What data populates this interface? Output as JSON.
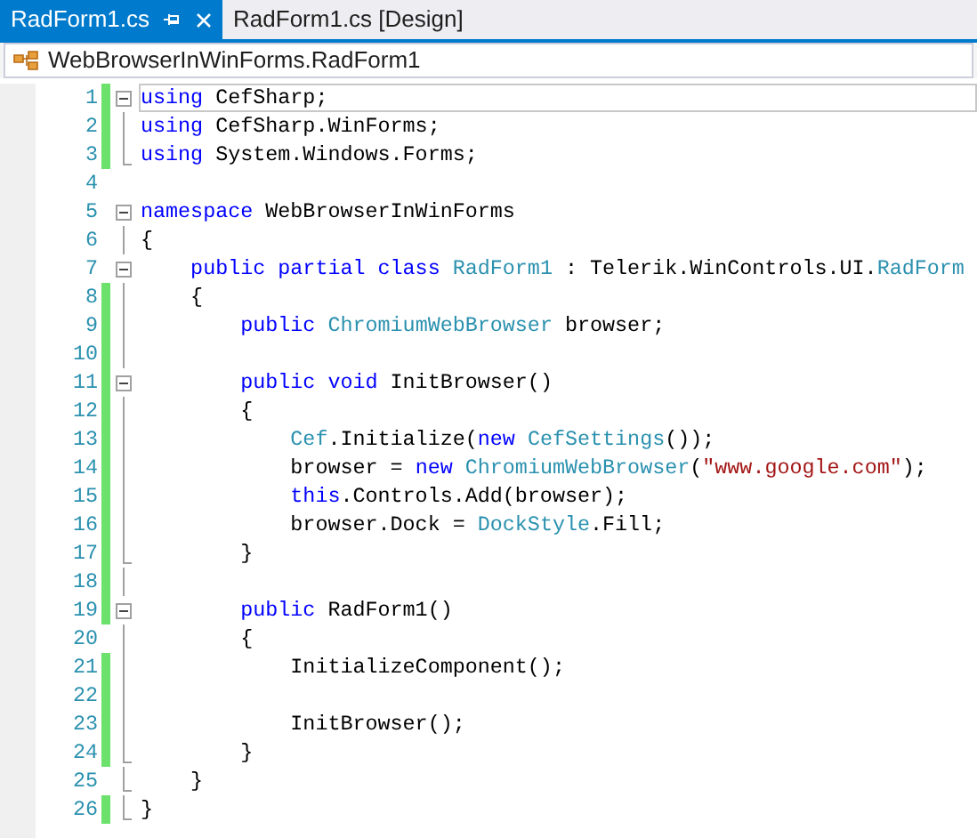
{
  "tabs": [
    {
      "label": "RadForm1.cs",
      "selected": true
    },
    {
      "label": "RadForm1.cs [Design]",
      "selected": false
    }
  ],
  "navigation": {
    "label": "WebBrowserInWinForms.RadForm1"
  },
  "lines": [
    {
      "number": "1",
      "changed": true,
      "current": true,
      "kind": "start",
      "tokens": [
        {
          "kind": "keyword",
          "text": "using"
        },
        {
          "kind": "plain",
          "text": " CefSharp;"
        }
      ]
    },
    {
      "number": "2",
      "changed": true,
      "current": false,
      "kind": "inside",
      "tokens": [
        {
          "kind": "keyword",
          "text": "using"
        },
        {
          "kind": "plain",
          "text": " CefSharp.WinForms;"
        }
      ]
    },
    {
      "number": "3",
      "changed": true,
      "current": false,
      "kind": "end",
      "tokens": [
        {
          "kind": "keyword",
          "text": "using"
        },
        {
          "kind": "plain",
          "text": " System.Windows.Forms;"
        }
      ]
    },
    {
      "number": "4",
      "changed": false,
      "current": false,
      "kind": "outside"
    },
    {
      "number": "5",
      "changed": false,
      "current": false,
      "kind": "start",
      "tokens": [
        {
          "kind": "keyword",
          "text": "namespace"
        },
        {
          "kind": "plain",
          "text": " WebBrowserInWinForms"
        }
      ]
    },
    {
      "number": "6",
      "changed": false,
      "current": false,
      "kind": "inside",
      "tokens": [
        {
          "kind": "plain",
          "text": "{"
        }
      ]
    },
    {
      "number": "7",
      "changed": false,
      "current": false,
      "kind": "start",
      "tokens": [
        {
          "kind": "keyword",
          "text": "    public partial class "
        },
        {
          "kind": "type",
          "text": "RadForm1"
        },
        {
          "kind": "plain",
          "text": " : Telerik.WinControls.UI."
        },
        {
          "kind": "type",
          "text": "RadForm"
        }
      ]
    },
    {
      "number": "8",
      "changed": true,
      "current": false,
      "kind": "inside",
      "tokens": [
        {
          "kind": "plain",
          "text": "    {"
        }
      ]
    },
    {
      "number": "9",
      "changed": true,
      "current": false,
      "kind": "inside",
      "tokens": [
        {
          "kind": "keyword",
          "text": "        public "
        },
        {
          "kind": "type",
          "text": "ChromiumWebBrowser"
        },
        {
          "kind": "plain",
          "text": " browser;"
        }
      ]
    },
    {
      "number": "10",
      "changed": true,
      "current": false,
      "kind": "inside"
    },
    {
      "number": "11",
      "changed": true,
      "current": false,
      "kind": "start",
      "tokens": [
        {
          "kind": "keyword",
          "text": "        public void"
        },
        {
          "kind": "plain",
          "text": " InitBrowser()"
        }
      ]
    },
    {
      "number": "12",
      "changed": true,
      "current": false,
      "kind": "inside",
      "tokens": [
        {
          "kind": "plain",
          "text": "        {"
        }
      ]
    },
    {
      "number": "13",
      "changed": true,
      "current": false,
      "kind": "inside",
      "tokens": [
        {
          "kind": "type",
          "text": "            Cef"
        },
        {
          "kind": "plain",
          "text": ".Initialize("
        },
        {
          "kind": "keyword",
          "text": "new "
        },
        {
          "kind": "type",
          "text": "CefSettings"
        },
        {
          "kind": "plain",
          "text": "());"
        }
      ]
    },
    {
      "number": "14",
      "changed": true,
      "current": false,
      "kind": "inside",
      "tokens": [
        {
          "kind": "plain",
          "text": "            browser = "
        },
        {
          "kind": "keyword",
          "text": "new "
        },
        {
          "kind": "type",
          "text": "ChromiumWebBrowser"
        },
        {
          "kind": "plain",
          "text": "("
        },
        {
          "kind": "string",
          "text": "\"www.google.com\""
        },
        {
          "kind": "plain",
          "text": ");"
        }
      ]
    },
    {
      "number": "15",
      "changed": true,
      "current": false,
      "kind": "inside",
      "tokens": [
        {
          "kind": "keyword",
          "text": "            this"
        },
        {
          "kind": "plain",
          "text": ".Controls.Add(browser);"
        }
      ]
    },
    {
      "number": "16",
      "changed": true,
      "current": false,
      "kind": "inside",
      "tokens": [
        {
          "kind": "plain",
          "text": "            browser.Dock = "
        },
        {
          "kind": "type",
          "text": "DockStyle"
        },
        {
          "kind": "plain",
          "text": ".Fill;"
        }
      ]
    },
    {
      "number": "17",
      "changed": true,
      "current": false,
      "kind": "end",
      "tokens": [
        {
          "kind": "plain",
          "text": "        }"
        }
      ]
    },
    {
      "number": "18",
      "changed": true,
      "current": false,
      "kind": "inside"
    },
    {
      "number": "19",
      "changed": true,
      "current": false,
      "kind": "start",
      "tokens": [
        {
          "kind": "keyword",
          "text": "        public"
        },
        {
          "kind": "plain",
          "text": " RadForm1()"
        }
      ]
    },
    {
      "number": "20",
      "changed": false,
      "current": false,
      "kind": "inside",
      "tokens": [
        {
          "kind": "plain",
          "text": "        {"
        }
      ]
    },
    {
      "number": "21",
      "changed": true,
      "current": false,
      "kind": "inside",
      "tokens": [
        {
          "kind": "plain",
          "text": "            InitializeComponent();"
        }
      ]
    },
    {
      "number": "22",
      "changed": true,
      "current": false,
      "kind": "inside"
    },
    {
      "number": "23",
      "changed": true,
      "current": false,
      "kind": "inside",
      "tokens": [
        {
          "kind": "plain",
          "text": "            InitBrowser();"
        }
      ]
    },
    {
      "number": "24",
      "changed": true,
      "current": false,
      "kind": "end",
      "tokens": [
        {
          "kind": "plain",
          "text": "        }"
        }
      ]
    },
    {
      "number": "25",
      "changed": false,
      "current": false,
      "kind": "end",
      "tokens": [
        {
          "kind": "plain",
          "text": "    }"
        }
      ]
    },
    {
      "number": "26",
      "changed": true,
      "current": false,
      "kind": "end",
      "tokens": [
        {
          "kind": "plain",
          "text": "}"
        }
      ]
    }
  ]
}
